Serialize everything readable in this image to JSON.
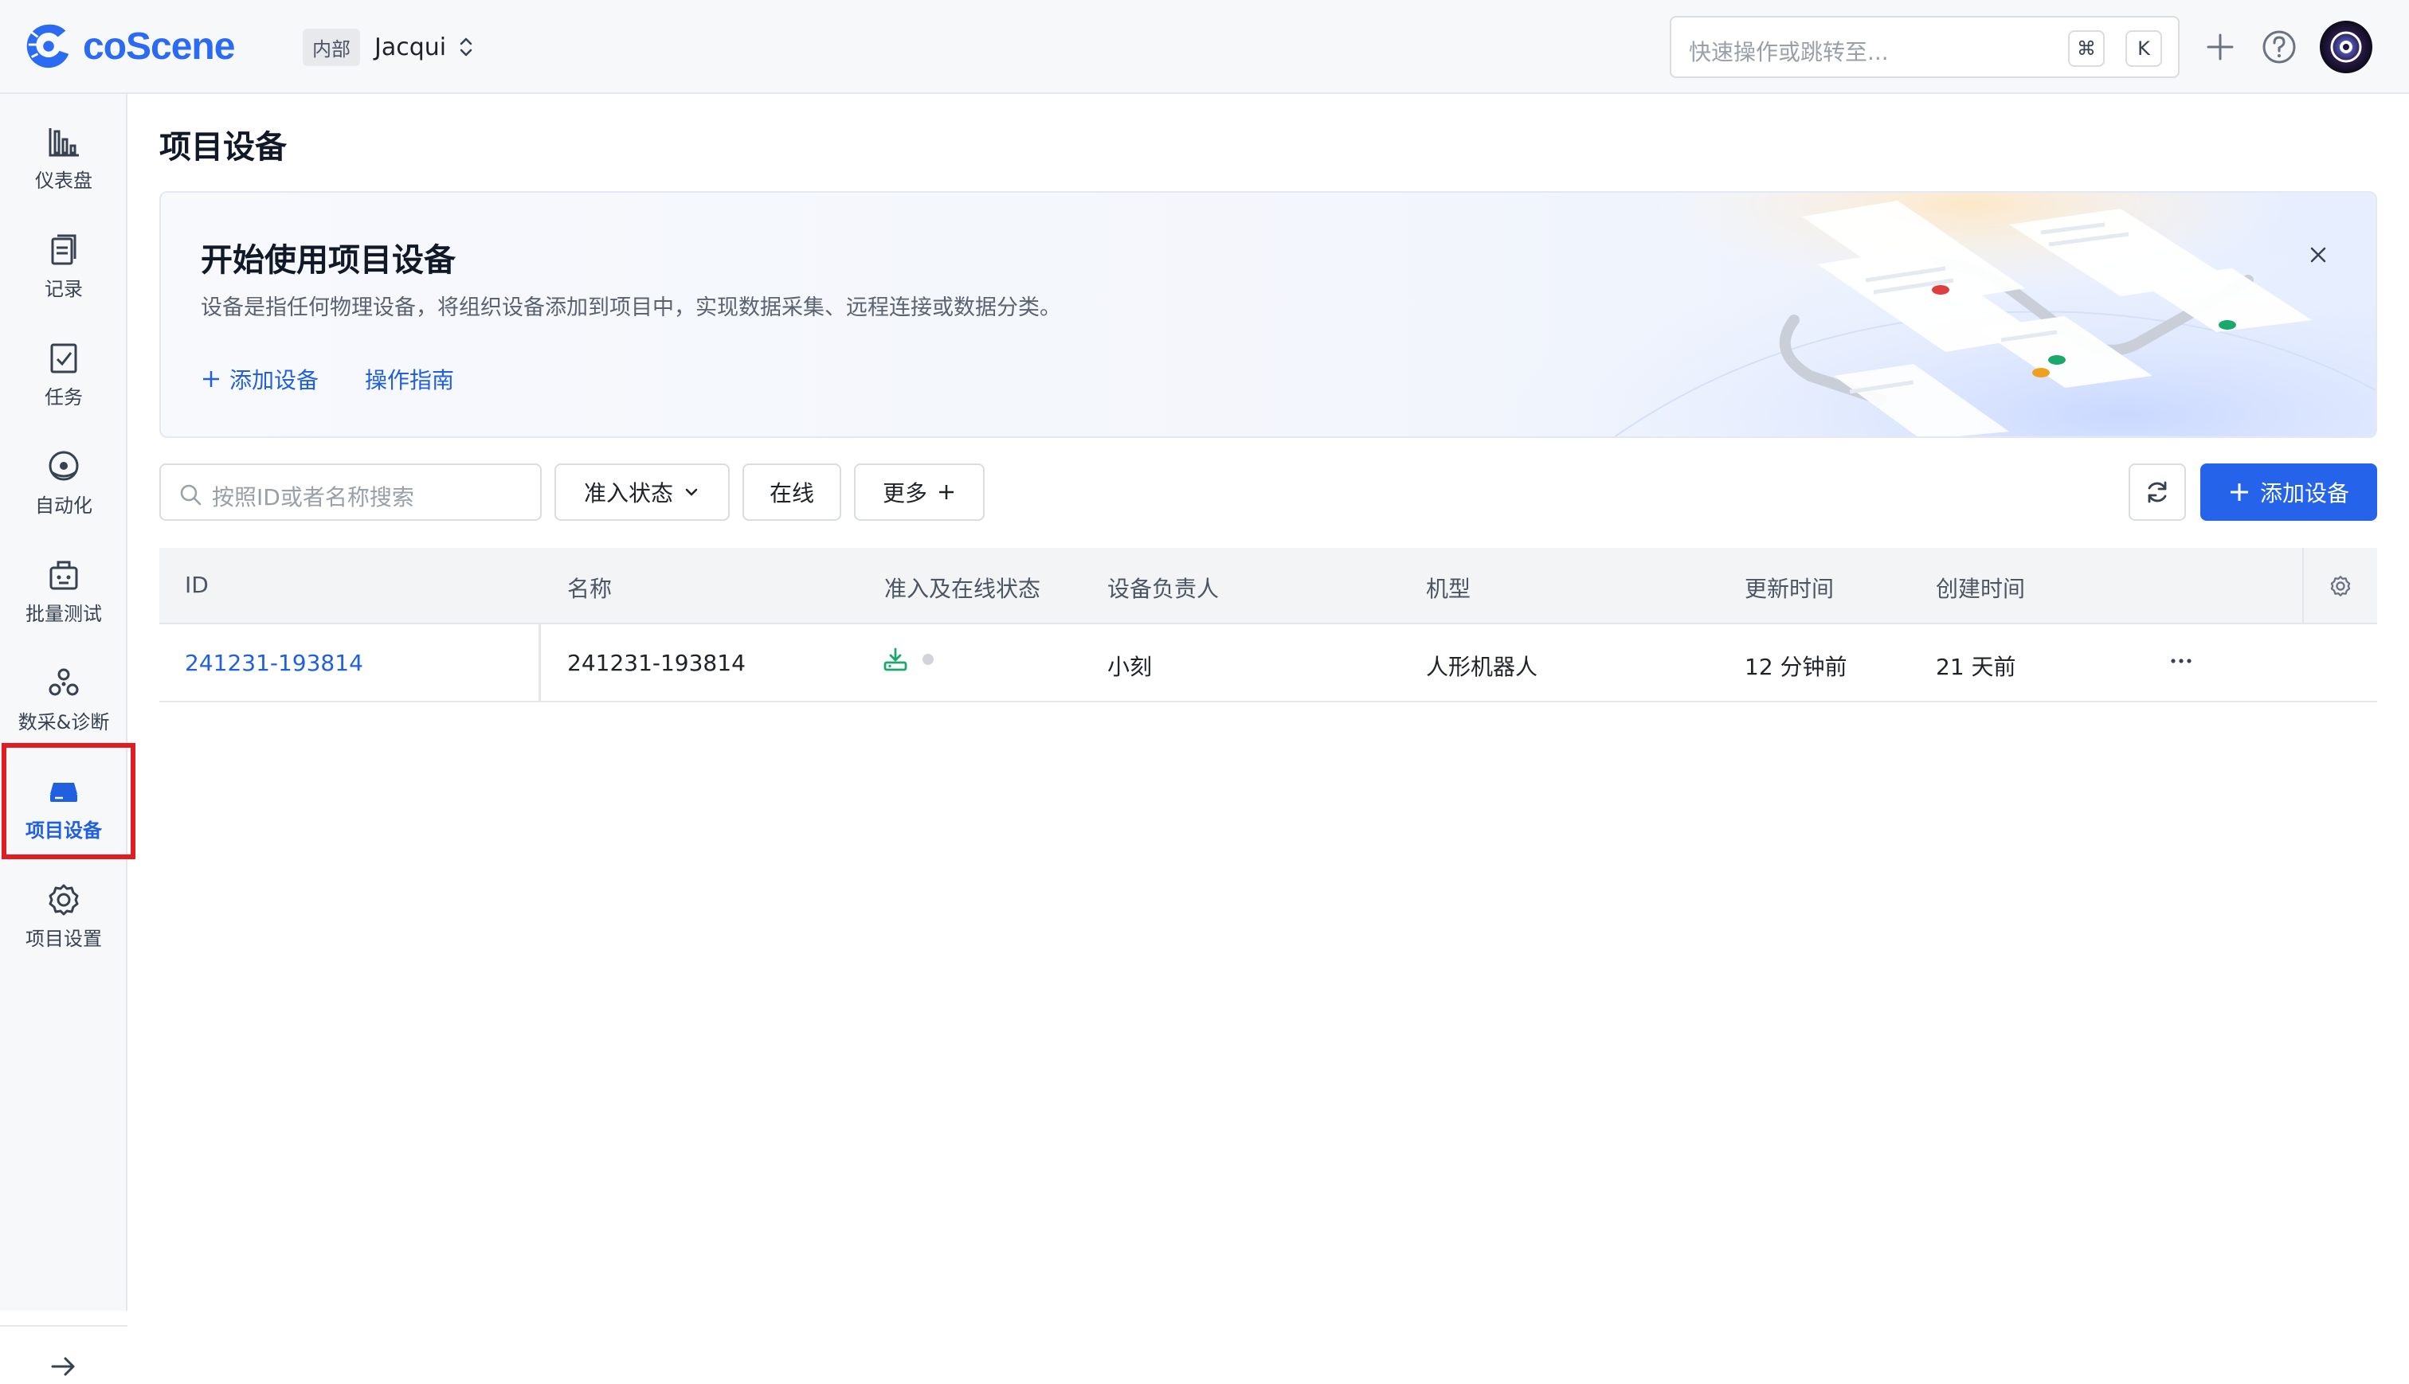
{
  "app": {
    "brand": "coScene",
    "org_tag": "内部",
    "org_name": "Jacqui",
    "search_placeholder": "快速操作或跳转至...",
    "shortcut_cmd": "⌘",
    "shortcut_key": "K",
    "accent_color": "#2563eb"
  },
  "sidebar": {
    "items": [
      {
        "label": "仪表盘",
        "icon": "bar-chart-icon"
      },
      {
        "label": "记录",
        "icon": "clipboard-icon"
      },
      {
        "label": "任务",
        "icon": "task-check-icon"
      },
      {
        "label": "自动化",
        "icon": "automation-icon"
      },
      {
        "label": "批量测试",
        "icon": "batch-test-icon"
      },
      {
        "label": "数采&诊断",
        "icon": "diagnosis-icon"
      },
      {
        "label": "项目设备",
        "icon": "device-icon",
        "active": true
      },
      {
        "label": "项目设置",
        "icon": "gear-icon"
      }
    ],
    "expand_icon": "arrow-right-icon"
  },
  "page": {
    "title": "项目设备"
  },
  "banner": {
    "title": "开始使用项目设备",
    "description": "设备是指任何物理设备，将组织设备添加到项目中，实现数据采集、远程连接或数据分类。",
    "add_label": "添加设备",
    "guide_label": "操作指南"
  },
  "toolbar": {
    "search_placeholder": "按照ID或者名称搜索",
    "filter_status": "准入状态",
    "filter_online": "在线",
    "more": "更多",
    "add_button": "添加设备"
  },
  "table": {
    "columns": [
      "ID",
      "名称",
      "准入及在线状态",
      "设备负责人",
      "机型",
      "更新时间",
      "创建时间"
    ],
    "rows": [
      {
        "id": "241231-193814",
        "name": "241231-193814",
        "owner": "小刻",
        "model": "人形机器人",
        "updated": "12 分钟前",
        "created": "21 天前"
      }
    ]
  }
}
